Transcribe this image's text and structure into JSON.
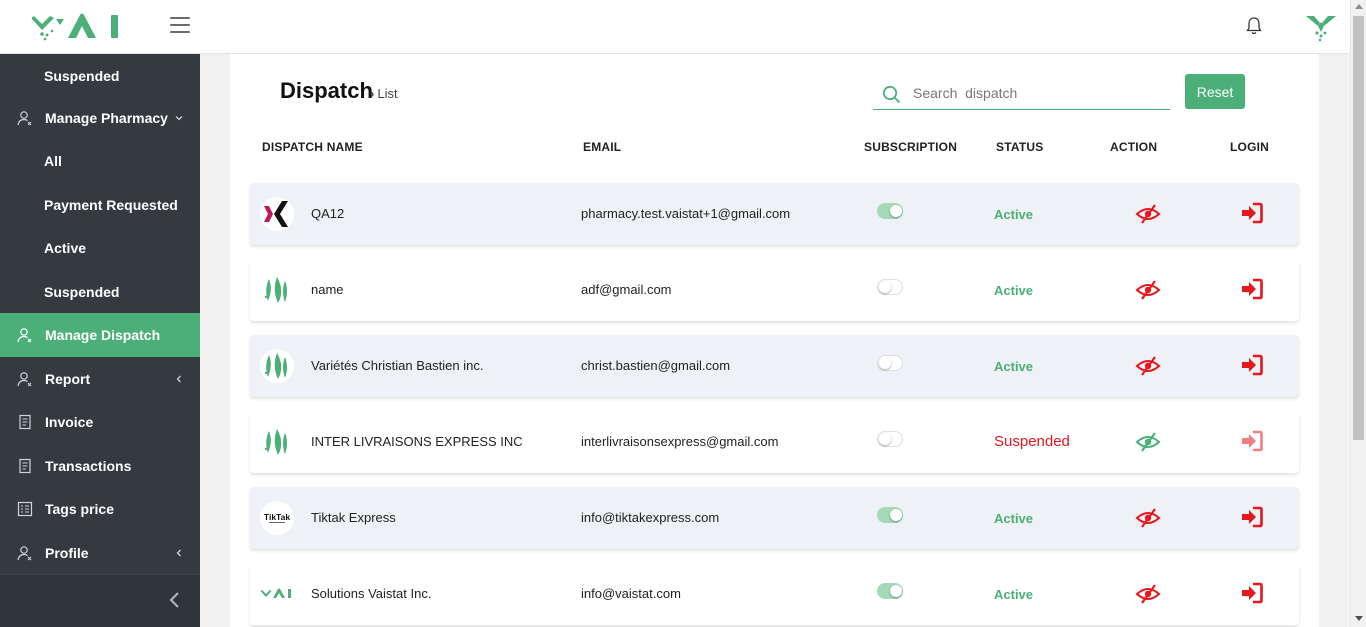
{
  "app": {
    "logo_text": "VAI"
  },
  "sidebar": {
    "items": [
      {
        "label": "Suspended",
        "type": "sub"
      },
      {
        "label": "Manage Pharmacy",
        "type": "main",
        "icon": "user-icon",
        "chevron": "down"
      },
      {
        "label": "All",
        "type": "sub"
      },
      {
        "label": "Payment Requested",
        "type": "sub"
      },
      {
        "label": "Active",
        "type": "sub"
      },
      {
        "label": "Suspended",
        "type": "sub"
      },
      {
        "label": "Manage Dispatch",
        "type": "main",
        "icon": "user-icon",
        "active": true
      },
      {
        "label": "Report",
        "type": "main",
        "icon": "user-icon",
        "chevron": "left"
      },
      {
        "label": "Invoice",
        "type": "main",
        "icon": "document-icon"
      },
      {
        "label": "Transactions",
        "type": "main",
        "icon": "document-icon"
      },
      {
        "label": "Tags price",
        "type": "main",
        "icon": "list-icon"
      },
      {
        "label": "Profile",
        "type": "main",
        "icon": "user-icon",
        "chevron": "left"
      }
    ]
  },
  "page": {
    "title": "Dispatch",
    "breadcrumb": "List",
    "search_placeholder": "Search  dispatch",
    "reset_label": "Reset"
  },
  "table": {
    "headers": {
      "name": "DISPATCH NAME",
      "email": "EMAIL",
      "subscription": "SUBSCRIPTION",
      "status": "STATUS",
      "action": "ACTION",
      "login": "LOGIN"
    },
    "rows": [
      {
        "name": "QA12",
        "email": "pharmacy.test.vaistat+1@gmail.com",
        "subscription": true,
        "status": "Active",
        "logo": "x-logo"
      },
      {
        "name": "name",
        "email": "adf@gmail.com",
        "subscription": false,
        "status": "Active",
        "logo": "vai-leaf-logo"
      },
      {
        "name": "Variétés Christian Bastien inc.",
        "email": "christ.bastien@gmail.com",
        "subscription": false,
        "status": "Active",
        "logo": "vai-leaf-logo"
      },
      {
        "name": "INTER LIVRAISONS EXPRESS INC",
        "email": "interlivraisonsexpress@gmail.com",
        "subscription": false,
        "status": "Suspended",
        "logo": "vai-leaf-logo"
      },
      {
        "name": "Tiktak Express",
        "email": "info@tiktakexpress.com",
        "subscription": true,
        "status": "Active",
        "logo": "tiktak-logo",
        "logo_text": "TikTak"
      },
      {
        "name": "Solutions Vaistat Inc.",
        "email": "info@vaistat.com",
        "subscription": true,
        "status": "Active",
        "logo": "vai-logo"
      }
    ]
  },
  "colors": {
    "brand_green": "#4caf78",
    "sidebar_bg": "#343a40",
    "danger_red": "#e3171c"
  }
}
